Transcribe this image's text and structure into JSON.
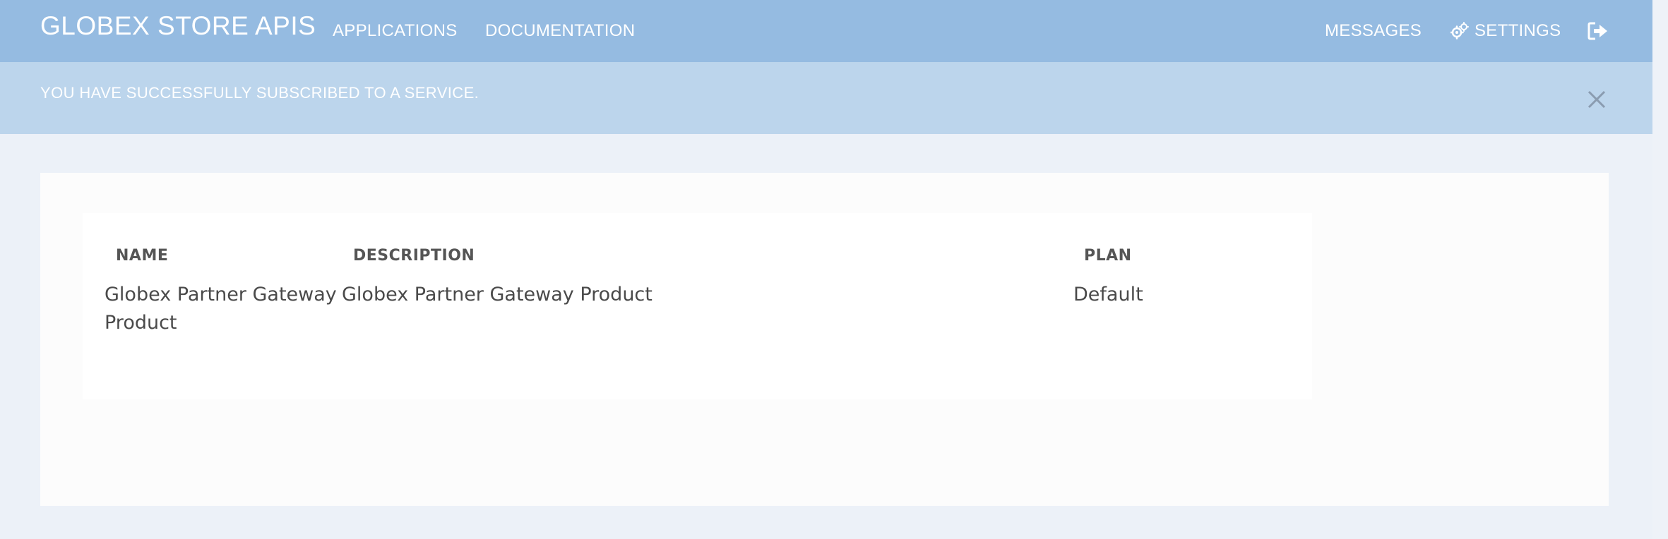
{
  "navbar": {
    "brand": "GLOBEX STORE APIS",
    "links": [
      {
        "label": "APPLICATIONS"
      },
      {
        "label": "DOCUMENTATION"
      }
    ],
    "right": {
      "messages_label": "MESSAGES",
      "settings_label": "SETTINGS",
      "settings_icon": "gears-icon",
      "logout_icon": "sign-out-icon"
    },
    "colors": {
      "background": "#95bbe1",
      "text": "#ffffff"
    }
  },
  "alert": {
    "message": "YOU HAVE SUCCESSFULLY SUBSCRIBED TO A SERVICE.",
    "close_icon": "close-icon",
    "background": "#bcd5ec"
  },
  "table": {
    "columns": [
      "NAME",
      "DESCRIPTION",
      "PLAN"
    ],
    "rows": [
      {
        "name": "Globex Partner Gateway Product",
        "description": "Globex Partner Gateway Product",
        "plan": "Default"
      }
    ]
  }
}
